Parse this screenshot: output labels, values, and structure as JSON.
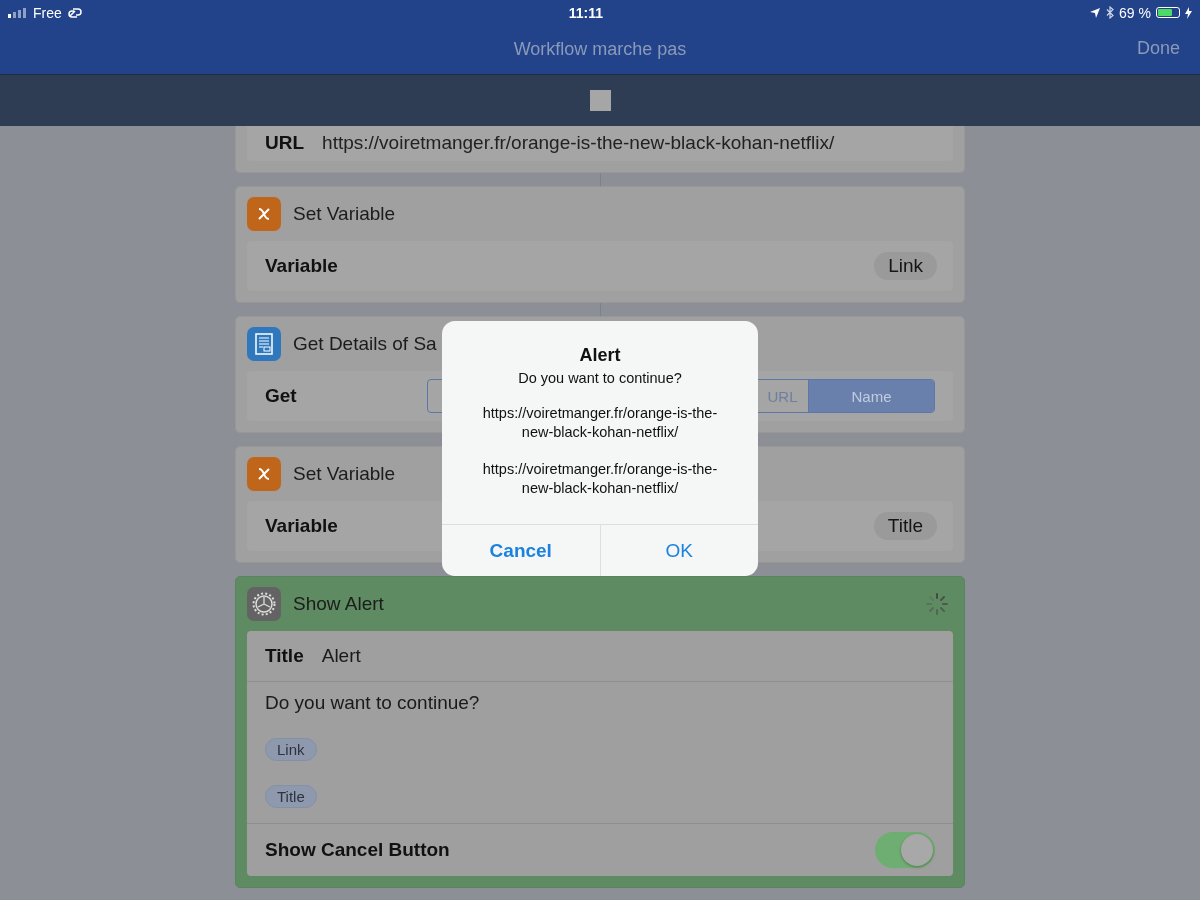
{
  "status_bar": {
    "carrier": "Free",
    "time": "11:11",
    "battery": "69 %"
  },
  "nav_bar": {
    "title": "Workflow marche pas",
    "done": "Done"
  },
  "actions": [
    {
      "kind": "url",
      "label": "URL",
      "value": "https://voiretmanger.fr/orange-is-the-new-black-kohan-netflix/"
    },
    {
      "kind": "set_variable",
      "title": "Set Variable",
      "field": "Variable",
      "token": "Link"
    },
    {
      "kind": "get_details",
      "title": "Get Details of Sa",
      "field": "Get",
      "segments": [
        {
          "label": "URL",
          "selected": false
        },
        {
          "label": "Name",
          "selected": true
        }
      ]
    },
    {
      "kind": "set_variable",
      "title": "Set Variable",
      "field": "Variable",
      "token": "Title"
    },
    {
      "kind": "show_alert",
      "title": "Show Alert",
      "running": true,
      "title_label": "Title",
      "title_value": "Alert",
      "message": "Do you want to continue?",
      "tokens": [
        "Link",
        "Title"
      ],
      "cancel_label": "Show Cancel Button",
      "cancel_on": true
    }
  ],
  "alert": {
    "title": "Alert",
    "message": "Do you want to continue?",
    "lines": [
      "https://voiretmanger.fr/orange-is-the-new-black-kohan-netflix/",
      "https://voiretmanger.fr/orange-is-the-new-black-kohan-netflix/"
    ],
    "buttons": [
      {
        "label": "Cancel",
        "kind": "cancel"
      },
      {
        "label": "OK",
        "kind": "default"
      }
    ]
  }
}
